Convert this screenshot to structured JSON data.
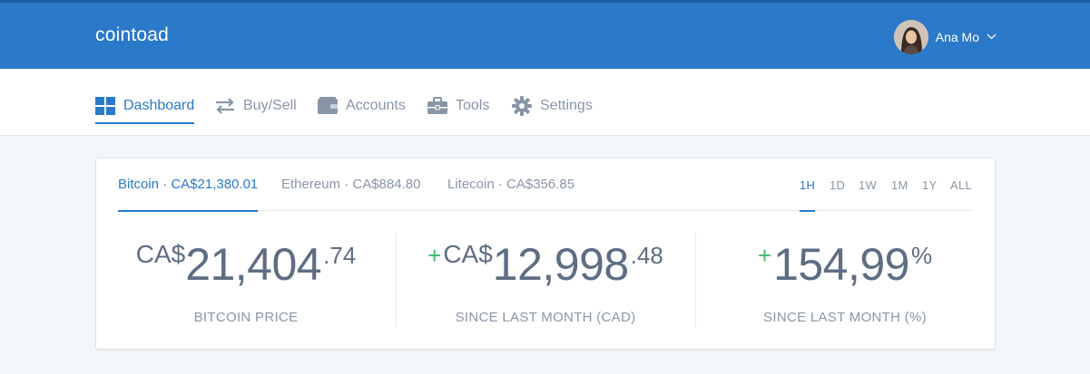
{
  "header": {
    "brand": "cointoad",
    "user_name": "Ana Mo",
    "user_menu_icon": "chevron-down-icon"
  },
  "nav": {
    "items": [
      {
        "label": "Dashboard",
        "icon": "dashboard-grid-icon",
        "active": true
      },
      {
        "label": "Buy/Sell",
        "icon": "swap-arrows-icon",
        "active": false
      },
      {
        "label": "Accounts",
        "icon": "wallet-icon",
        "active": false
      },
      {
        "label": "Tools",
        "icon": "toolbox-icon",
        "active": false
      },
      {
        "label": "Settings",
        "icon": "gear-icon",
        "active": false
      }
    ]
  },
  "coins": [
    {
      "label": "Bitcoin · CA$21,380.01",
      "active": true
    },
    {
      "label": "Ethereum · CA$884.80",
      "active": false
    },
    {
      "label": "Litecoin · CA$356.85",
      "active": false
    }
  ],
  "ranges": [
    {
      "label": "1H",
      "active": true
    },
    {
      "label": "1D",
      "active": false
    },
    {
      "label": "1W",
      "active": false
    },
    {
      "label": "1M",
      "active": false
    },
    {
      "label": "1Y",
      "active": false
    },
    {
      "label": "ALL",
      "active": false
    }
  ],
  "stats": [
    {
      "prefix": "",
      "currency": "CA$",
      "integer": "21,404",
      "decimal": ".74",
      "suffix": "",
      "label": "BITCOIN PRICE"
    },
    {
      "prefix": "+",
      "currency": "CA$",
      "integer": "12,998",
      "decimal": ".48",
      "suffix": "",
      "label": "SINCE LAST MONTH (CAD)"
    },
    {
      "prefix": "+",
      "currency": "",
      "integer": "154,99",
      "decimal": "",
      "suffix": "%",
      "label": "SINCE LAST MONTH (%)"
    }
  ],
  "colors": {
    "primary": "#2b79c9",
    "positive": "#3cbc6d",
    "muted": "#8a96a6",
    "value": "#5e6d83"
  }
}
